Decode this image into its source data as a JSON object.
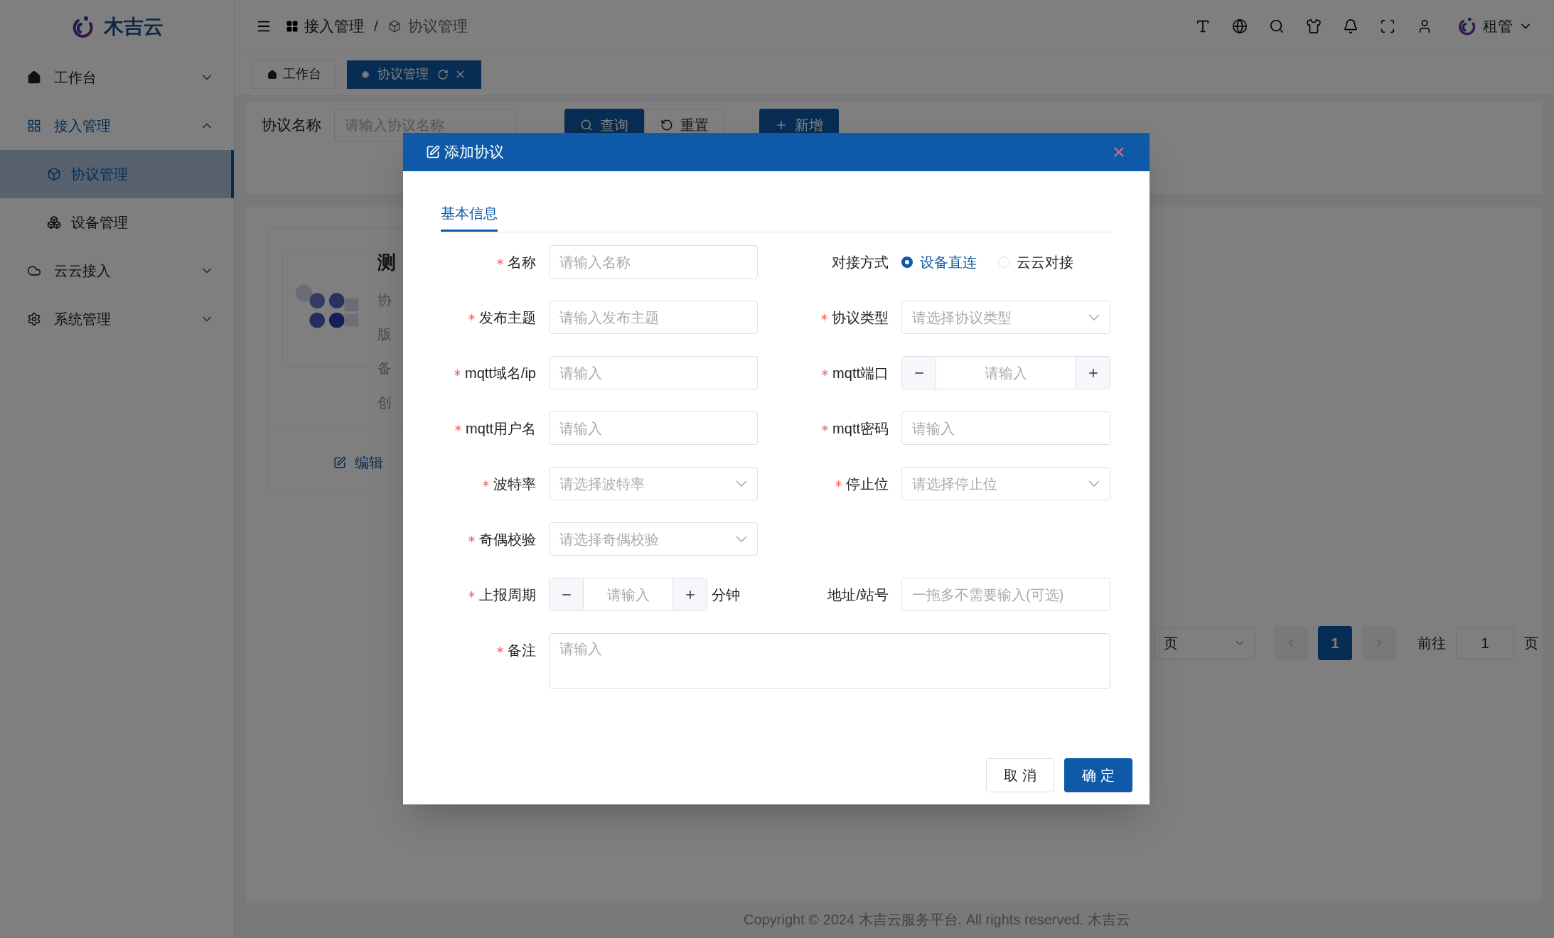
{
  "sidebar": {
    "logo_text": "木吉云",
    "items": [
      {
        "label": "工作台",
        "expanded": false
      },
      {
        "label": "接入管理",
        "expanded": true,
        "children": [
          {
            "label": "协议管理",
            "selected": true
          },
          {
            "label": "设备管理",
            "selected": false
          }
        ]
      },
      {
        "label": "云云接入",
        "expanded": false
      },
      {
        "label": "系统管理",
        "expanded": false
      }
    ]
  },
  "header": {
    "breadcrumbs": [
      "接入管理",
      "协议管理"
    ],
    "separator": "/",
    "user": "租管"
  },
  "tabs": [
    {
      "label": "工作台",
      "selected": false
    },
    {
      "label": "协议管理",
      "selected": true
    }
  ],
  "search": {
    "label": "协议名称",
    "placeholder": "请输入协议名称",
    "buttons": [
      {
        "label": "查询",
        "kind": "primary"
      },
      {
        "label": "重置",
        "kind": "default"
      },
      {
        "label": "新增",
        "kind": "primary"
      }
    ]
  },
  "cards": [
    {
      "title": "测",
      "lines": [
        "协",
        "版",
        "备",
        "创"
      ],
      "action": "编辑"
    }
  ],
  "pagination": {
    "page_size": "页",
    "pages": [
      {
        "label": "1",
        "selected": true
      }
    ],
    "goto_label": "前往",
    "goto_value": "1",
    "goto_suffix": "页"
  },
  "footer": "Copyright © 2024 木吉云服务平台. All rights reserved. 木吉云",
  "dialog": {
    "title": "添加协议",
    "tabs": [
      {
        "label": "基本信息",
        "selected": true
      }
    ],
    "rows": [
      [
        {
          "kind": "text",
          "label": "名称",
          "required": true,
          "placeholder": "请输入名称"
        },
        {
          "kind": "radio",
          "label": "对接方式",
          "required": false,
          "options": [
            {
              "label": "设备直连",
              "selected": true
            },
            {
              "label": "云云对接",
              "selected": false
            }
          ]
        }
      ],
      [
        {
          "kind": "text",
          "label": "发布主题",
          "required": true,
          "placeholder": "请输入发布主题"
        },
        {
          "kind": "select",
          "label": "协议类型",
          "required": true,
          "placeholder": "请选择协议类型"
        }
      ],
      [
        {
          "kind": "text",
          "label": "mqtt域名/ip",
          "required": true,
          "placeholder": "请输入"
        },
        {
          "kind": "number",
          "label": "mqtt端口",
          "required": true,
          "placeholder": "请输入"
        }
      ],
      [
        {
          "kind": "text",
          "label": "mqtt用户名",
          "required": true,
          "placeholder": "请输入"
        },
        {
          "kind": "text",
          "label": "mqtt密码",
          "required": true,
          "placeholder": "请输入"
        }
      ],
      [
        {
          "kind": "select",
          "label": "波特率",
          "required": true,
          "placeholder": "请选择波特率"
        },
        {
          "kind": "select",
          "label": "停止位",
          "required": true,
          "placeholder": "请选择停止位"
        }
      ],
      [
        {
          "kind": "select",
          "label": "奇偶校验",
          "required": true,
          "placeholder": "请选择奇偶校验"
        }
      ],
      [
        {
          "kind": "number",
          "label": "上报周期",
          "required": true,
          "placeholder": "请输入",
          "unit": "分钟"
        },
        {
          "kind": "text",
          "label": "地址/站号",
          "required": false,
          "placeholder": "一拖多不需要输入(可选)"
        }
      ],
      [
        {
          "kind": "textarea",
          "label": "备注",
          "required": true,
          "placeholder": "请输入"
        }
      ]
    ],
    "buttons": [
      {
        "label": "取 消",
        "kind": "default"
      },
      {
        "label": "确 定",
        "kind": "primary"
      }
    ]
  }
}
